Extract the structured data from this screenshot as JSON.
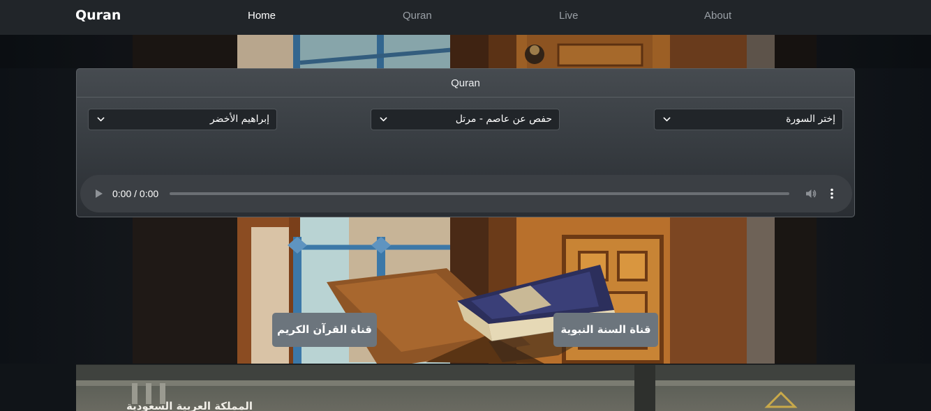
{
  "navbar": {
    "brand": "Quran",
    "links": [
      {
        "label": "Home",
        "active": true
      },
      {
        "label": "Quran",
        "active": false
      },
      {
        "label": "Live",
        "active": false
      },
      {
        "label": "About",
        "active": false
      }
    ]
  },
  "player": {
    "title": "Quran",
    "reciter_select": {
      "value": "إبراهيم الأخضر",
      "icon": "chevron-down-icon"
    },
    "riwaya_select": {
      "value": "حفص عن عاصم - مرتل",
      "icon": "chevron-down-icon"
    },
    "surah_select": {
      "value": "إختر السورة",
      "icon": "chevron-down-icon"
    },
    "audio": {
      "time": "0:00 / 0:00",
      "progress": 0,
      "icons": [
        "play-icon",
        "volume-icon",
        "more-options-icon"
      ]
    }
  },
  "channels": {
    "quran_channel": "قناة القرآن الكريم",
    "sunnah_channel": "قناة السنة النبوية"
  },
  "banner": {
    "text": "المملكة العربية السعودية"
  },
  "colors": {
    "navbar_bg": "#212529",
    "card_bg": "#3e4348",
    "button_bg": "#6c757d",
    "select_bg": "#212529"
  }
}
